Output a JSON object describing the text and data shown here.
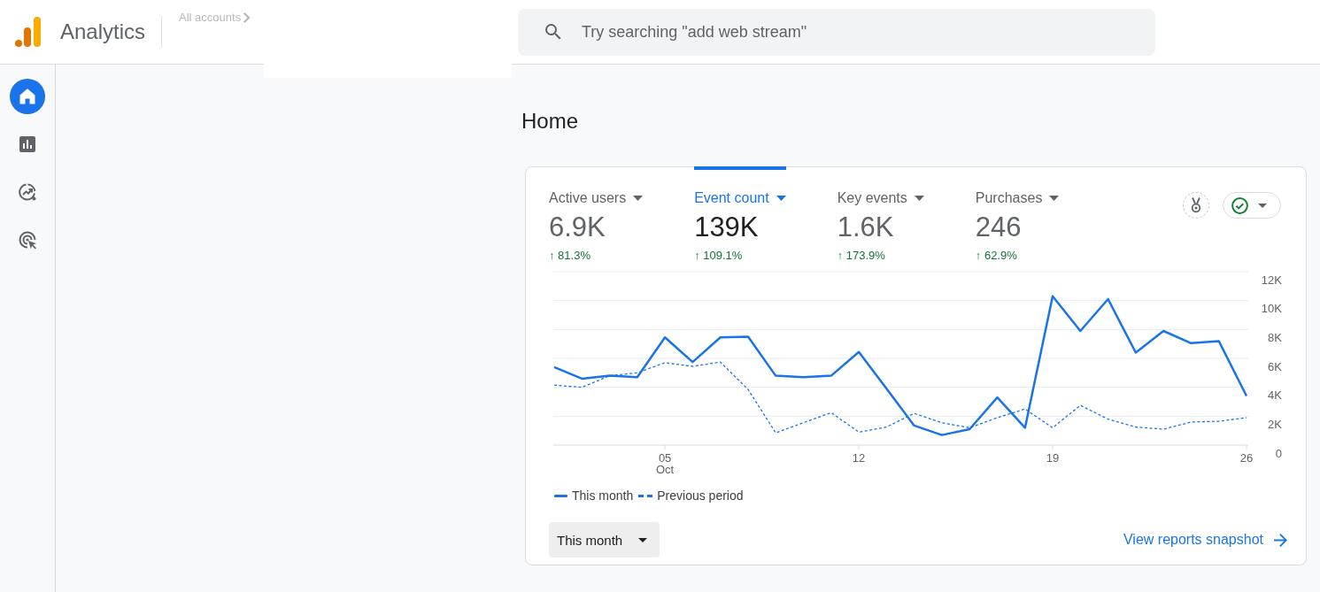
{
  "header": {
    "product_name": "Analytics",
    "breadcrumb": "All accounts",
    "search": {
      "placeholder": "Try searching \"add web stream\""
    }
  },
  "sidebar": {
    "items": [
      {
        "kind": "home",
        "selected": true
      },
      {
        "kind": "reports",
        "selected": false
      },
      {
        "kind": "explore",
        "selected": false
      },
      {
        "kind": "advertising",
        "selected": false
      }
    ]
  },
  "page": {
    "title": "Home"
  },
  "card": {
    "metrics": [
      {
        "label": "Active users",
        "value": "6.9K",
        "change": "↑ 81.3%",
        "selected": false
      },
      {
        "label": "Event count",
        "value": "139K",
        "change": "↑ 109.1%",
        "selected": true
      },
      {
        "label": "Key events",
        "value": "1.6K",
        "change": "↑ 173.9%",
        "selected": false
      },
      {
        "label": "Purchases",
        "value": "246",
        "change": "↑ 62.9%",
        "selected": false
      }
    ],
    "chart": {
      "chart_data": {
        "type": "line",
        "x": [
          1,
          2,
          3,
          4,
          5,
          6,
          7,
          8,
          9,
          10,
          11,
          12,
          13,
          14,
          15,
          16,
          17,
          18,
          19,
          20,
          21,
          22,
          23,
          24,
          25,
          26
        ],
        "series": [
          {
            "name": "This month",
            "color": "#1a73e8",
            "line_style": "solid",
            "values": [
              5400,
              4600,
              4800,
              4700,
              7450,
              5750,
              7450,
              7500,
              4800,
              4700,
              4800,
              6450,
              3900,
              1350,
              700,
              1100,
              3300,
              1200,
              10300,
              7900,
              10100,
              6400,
              7900,
              7050,
              7200,
              3400
            ]
          },
          {
            "name": "Previous period",
            "color": "#1a73e8",
            "line_style": "dashed",
            "values": [
              4150,
              4000,
              4800,
              5000,
              5700,
              5450,
              5750,
              3850,
              850,
              1550,
              2250,
              900,
              1250,
              2200,
              1550,
              1200,
              1900,
              2500,
              1200,
              2750,
              1800,
              1250,
              1100,
              1600,
              1650,
              1900
            ]
          }
        ],
        "xlim": [
          1,
          26
        ],
        "ylim": [
          0,
          12000
        ],
        "grid": true,
        "xticks": [
          {
            "value": 5,
            "label": "05"
          },
          {
            "value": 12,
            "label": "12"
          },
          {
            "value": 19,
            "label": "19"
          },
          {
            "value": 26,
            "label": "26"
          }
        ],
        "yticks": [
          {
            "value": 0,
            "label": "0"
          },
          {
            "value": 2000,
            "label": "2K"
          },
          {
            "value": 4000,
            "label": "4K"
          },
          {
            "value": 6000,
            "label": "6K"
          },
          {
            "value": 8000,
            "label": "8K"
          },
          {
            "value": 10000,
            "label": "10K"
          },
          {
            "value": 12000,
            "label": "12K"
          }
        ],
        "annotations": [
          "Oct"
        ]
      }
    },
    "date_range": {
      "label": "This month"
    },
    "link": {
      "label": "View reports snapshot"
    }
  }
}
